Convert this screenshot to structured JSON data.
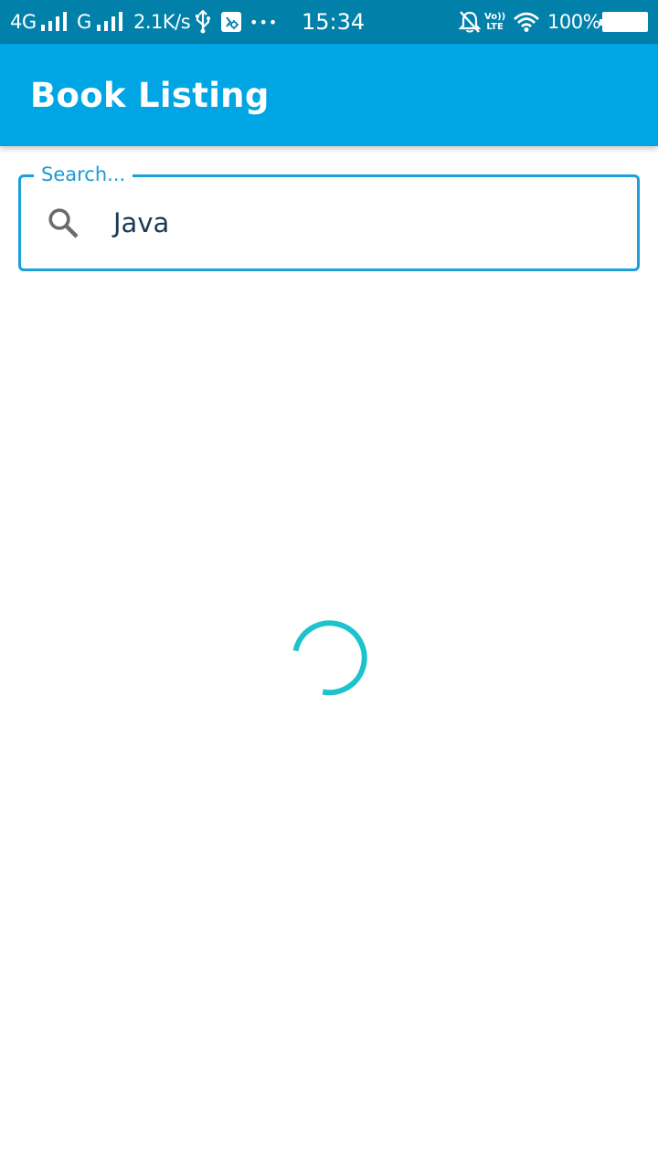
{
  "status_bar": {
    "network_1": "4G",
    "network_2": "G",
    "speed": "2.1K/s",
    "more": "•••",
    "time": "15:34",
    "battery": "100%",
    "icons": [
      "signal-icon",
      "signal-icon",
      "usb-icon",
      "debug-icon",
      "notifications-off-icon",
      "volte-icon",
      "wifi-icon",
      "battery-icon"
    ],
    "volte_top": "Vo))",
    "volte_bottom": "LTE"
  },
  "app_bar": {
    "title": "Book Listing",
    "color": "#00a5e4"
  },
  "search": {
    "label": "Search...",
    "value": "Java",
    "icon": "search-icon",
    "accent": "#1ba0db"
  },
  "loading": {
    "icon": "progress-spinner",
    "color": "#1cc3cc"
  }
}
